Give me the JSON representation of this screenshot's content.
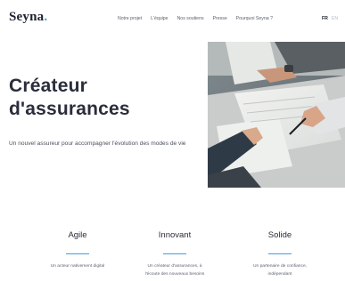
{
  "header": {
    "logo": "Seyna",
    "logo_dot": ".",
    "nav": [
      "Notre projet",
      "L'équipe",
      "Nos soutiens",
      "Presse",
      "Pourquoi Seyna ?"
    ],
    "lang": {
      "fr": "FR",
      "en": "EN"
    }
  },
  "hero": {
    "title_line1": "Créateur",
    "title_line2": "d'assurances",
    "subtitle": "Un nouvel assureur pour accompagner l'évolution des modes de vie"
  },
  "features": [
    {
      "title": "Agile",
      "desc_line1": "Un acteur nativement digital",
      "desc_line2": ""
    },
    {
      "title": "Innovant",
      "desc_line1": "Un créateur d'assurances, à",
      "desc_line2": "l'écoute des nouveaux besoins"
    },
    {
      "title": "Solide",
      "desc_line1": "Un partenaire de confiance,",
      "desc_line2": "indépendant"
    }
  ],
  "colors": {
    "accent": "#3aa0e6",
    "text": "#2a2d3b"
  }
}
